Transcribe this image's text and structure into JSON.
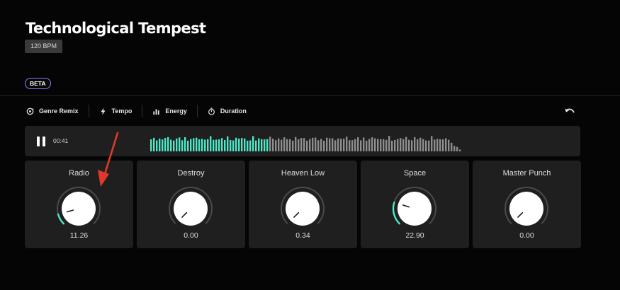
{
  "header": {
    "title": "Technological Tempest",
    "bpm": "120 BPM",
    "badge": "BETA"
  },
  "toolbar": {
    "items": [
      {
        "label": "Genre Remix",
        "icon": "genre-remix-icon"
      },
      {
        "label": "Tempo",
        "icon": "lightning-icon"
      },
      {
        "label": "Energy",
        "icon": "bar-chart-icon"
      },
      {
        "label": "Duration",
        "icon": "stopwatch-icon"
      }
    ],
    "undo_icon": "undo-icon"
  },
  "player": {
    "state_icon": "pause-icon",
    "time": "00:41",
    "progress": 0.38
  },
  "knobs": [
    {
      "label": "Radio",
      "value": "11.26",
      "level": 0.11
    },
    {
      "label": "Destroy",
      "value": "0.00",
      "level": 0
    },
    {
      "label": "Heaven Low",
      "value": "0.34",
      "level": 0
    },
    {
      "label": "Space",
      "value": "22.90",
      "level": 0.23
    },
    {
      "label": "Master Punch",
      "value": "0.00",
      "level": 0
    }
  ],
  "colors": {
    "accent": "#4de8c8",
    "waveform_inactive": "#8e8e8e",
    "badge_border": "#8c7fff",
    "annotation_arrow": "#e0392b",
    "card": "#1f1f1f"
  }
}
